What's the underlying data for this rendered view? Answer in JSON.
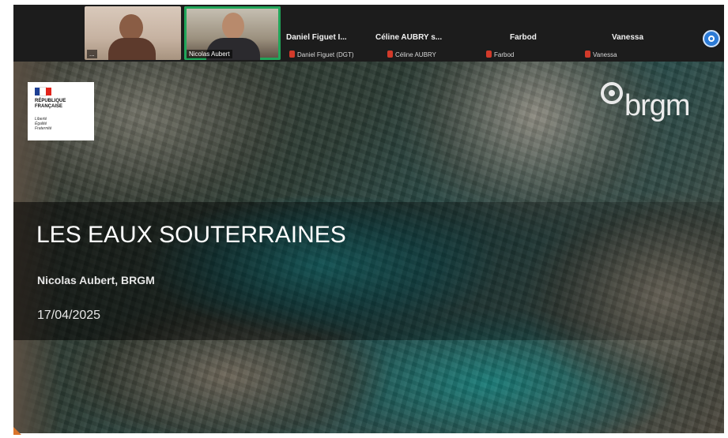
{
  "meeting": {
    "participants": [
      {
        "name": "...",
        "video_name": "..."
      },
      {
        "name": "...",
        "video_name": "Nicolas Aubert"
      }
    ],
    "header_names": [
      "Daniel Figuet I...",
      "Céline AUBRY s...",
      "Farbod",
      "Vanessa"
    ],
    "mute_labels": [
      "Daniel Figuet (DGT)",
      "Céline AUBRY",
      "Farbod",
      "Vanessa"
    ],
    "colors": {
      "bar": "#1c1c1c",
      "active_speaker": "#21a65a",
      "mute": "#d23a2a",
      "info_button": "#2b7ad6"
    }
  },
  "slide": {
    "logo_left": {
      "lines": "RÉPUBLIQUE\nFRANÇAISE",
      "motto": "Liberté\nÉgalité\nFraternité",
      "flag_colors": [
        "#1d3f94",
        "#ffffff",
        "#e2231a"
      ]
    },
    "logo_right": {
      "text": "brgm",
      "icon": "brgm-mark-icon"
    },
    "title": "LES EAUX SOUTERRAINES",
    "author": "Nicolas Aubert, BRGM",
    "date": "17/04/2025"
  }
}
